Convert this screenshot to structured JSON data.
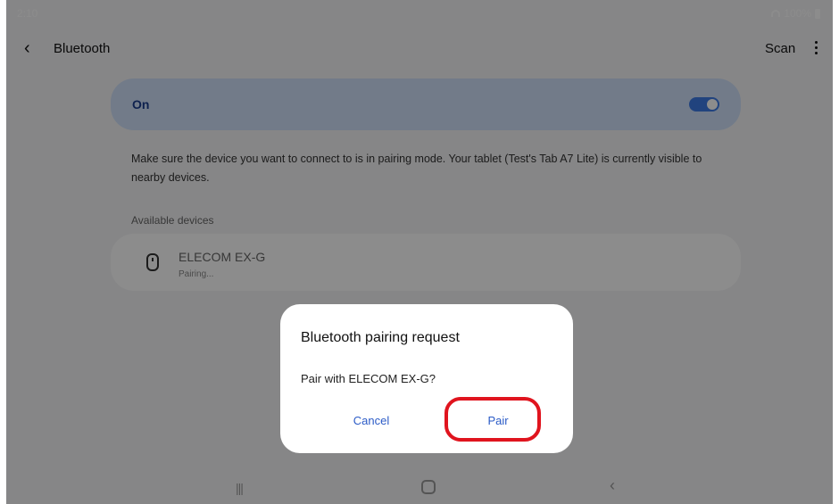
{
  "status_bar": {
    "time": "2:10",
    "battery": "100%",
    "icons": [
      "wifi-icon",
      "battery-icon"
    ]
  },
  "app_bar": {
    "back_icon": "back-icon",
    "title": "Bluetooth",
    "scan_label": "Scan",
    "more_icon": "more-icon"
  },
  "toggle": {
    "label": "On",
    "state": true,
    "accent": "#3d7ae6"
  },
  "info_text": "Make sure the device you want to connect to is in pairing mode. Your tablet (Test's Tab A7 Lite) is currently visible to nearby devices.",
  "available_devices": {
    "header": "Available devices",
    "items": [
      {
        "icon": "mouse-icon",
        "name": "ELECOM EX-G",
        "status": "Pairing..."
      }
    ]
  },
  "dialog": {
    "title": "Bluetooth pairing request",
    "message": "Pair with ELECOM EX-G?",
    "cancel_label": "Cancel",
    "pair_label": "Pair",
    "highlight_color": "#e0141e"
  },
  "nav_bar": {
    "icons": [
      "recents-icon",
      "home-icon",
      "back-icon"
    ],
    "recents_glyph": "|||",
    "back_glyph": "‹"
  }
}
